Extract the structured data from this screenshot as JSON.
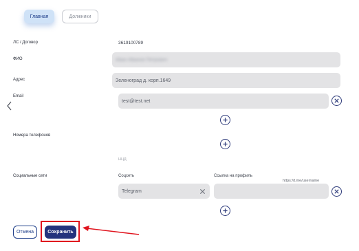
{
  "tabs": [
    {
      "label": "Главная",
      "active": true
    },
    {
      "label": "Должники",
      "active": false
    }
  ],
  "form": {
    "account_label": "ЛС / Договор",
    "account_value": "3619100789",
    "fio_label": "ФИО",
    "fio_value": "Иван Иванов Петрович",
    "address_label": "Адрес",
    "address_value": "Зеленоград д. корп.1649",
    "email_label": "Email",
    "email_value": "test@test.net",
    "phones_label": "Номера телефонов",
    "phone_hint": "НЦД",
    "social_label": "Социальные сети",
    "social_network_header": "Соцсеть",
    "profile_link_header": "Ссылка на профиль",
    "profile_link_placeholder": "https://t.me/username",
    "social_network_value": "Telegram",
    "profile_link_value": ""
  },
  "buttons": {
    "cancel_label": "Отмена",
    "save_label": "Сохранить"
  },
  "colors": {
    "accent": "#24337d",
    "highlight": "#e0141e",
    "field_bg": "#e3e3e5",
    "active_tab_bg": "#cfe2f7"
  },
  "icons": [
    "chevron-left-icon",
    "close-circle-icon",
    "plus-circle-icon",
    "clear-x-icon",
    "arrow-annotation"
  ]
}
